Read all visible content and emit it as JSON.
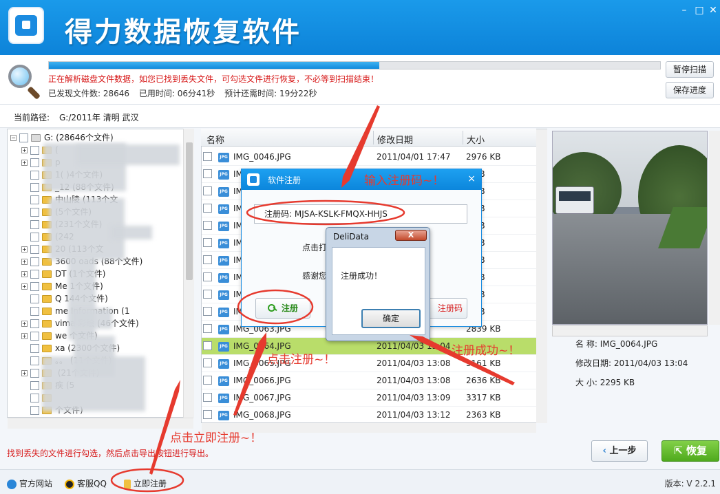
{
  "window": {
    "app_title": "得力数据恢复软件",
    "minimize": "–",
    "maximize": "□",
    "close": "✕"
  },
  "scan": {
    "progress_fraction": 0.54,
    "message": "正在解析磁盘文件数据，如您已找到丢失文件，可勾选文件进行恢复，不必等到扫描结束！",
    "found_files": "已发现文件数: 28646",
    "elapsed": "已用时间: 06分41秒",
    "remaining": "预计还需时间: 19分22秒",
    "pause_button": "暂停扫描",
    "save_button": "保存进度"
  },
  "path": {
    "label": "当前路径:",
    "value": "G:/2011年 清明  武汉"
  },
  "tree": {
    "root": "G:  (28646个文件)",
    "items": [
      "(",
      "p",
      "1(  )4个文件)",
      "_12  (88个文件)",
      "中山陵  (113个文",
      "(5个文件)",
      "(231个文件)",
      "(242",
      "20   (113个文",
      "3600   oads  (88个文件)",
      "DT   (1个文件)",
      "Me   1个文件)",
      "Q   144个文件)",
      "me Information  (1",
      "vima   彩绘  (46个文件)",
      "we   个文件)",
      "xa   (2300个文件)",
      "。。  (11个文件)",
      "  (21个文件)",
      "疾  (5",
      "",
      "个文件)"
    ]
  },
  "filelist": {
    "columns": [
      "名称",
      "修改日期",
      "大小"
    ],
    "rows": [
      {
        "name": "IMG_0046.JPG",
        "date": "2011/04/01 17:47",
        "size": "2976 KB"
      },
      {
        "name": "IM",
        "date": "",
        "size": "5 KB"
      },
      {
        "name": "IM",
        "date": "",
        "size": "2 KB"
      },
      {
        "name": "IM",
        "date": "",
        "size": "1 KB"
      },
      {
        "name": "IM",
        "date": "",
        "size": "5 KB"
      },
      {
        "name": "IM",
        "date": "",
        "size": "0 KB"
      },
      {
        "name": "IM",
        "date": "",
        "size": "2 KB"
      },
      {
        "name": "IM",
        "date": "",
        "size": "2 KB"
      },
      {
        "name": "IM",
        "date": "",
        "size": "4 KB"
      },
      {
        "name": "IM",
        "date": "",
        "size": "3 KB"
      },
      {
        "name": "IMG_0063.JPG",
        "date": "3:03",
        "size": "2839 KB"
      },
      {
        "name": "IMG_0064.JPG",
        "date": "2011/04/03 13:04",
        "size": ""
      },
      {
        "name": "IMG_0065.JPG",
        "date": "2011/04/03 13:08",
        "size": "3161 KB"
      },
      {
        "name": "IMG_0066.JPG",
        "date": "2011/04/03 13:08",
        "size": "2636 KB"
      },
      {
        "name": "IMG_0067.JPG",
        "date": "2011/04/03 13:09",
        "size": "3317 KB"
      },
      {
        "name": "IMG_0068.JPG",
        "date": "2011/04/03 13:12",
        "size": "2363 KB"
      }
    ],
    "jpg_badge": "JPG",
    "selected_row_color": "#b9dd6a"
  },
  "preview": {
    "name_label": "名    称:",
    "name_value": "IMG_0064.JPG",
    "date_label": "修改日期:",
    "date_value": "2011/04/03 13:04",
    "size_label": "大    小:",
    "size_value": "2295 KB"
  },
  "bottom": {
    "hint": "找到丢失的文件进行勾选，然后点击导出按钮进行导出。",
    "prev_button": "上一步",
    "recover_button": "恢复"
  },
  "footer": {
    "website": "官方网站",
    "qq": "客服QQ",
    "register": "立即注册",
    "version": "版本: V 2.2.1"
  },
  "reg_dialog": {
    "title": "软件注册",
    "close": "×",
    "code_label": "注册码:",
    "code_value": "MJSA-KSLK-FMQX-HHJS",
    "text1": "点击打",
    "text2": "感谢您",
    "register_button": "注册",
    "buy_button": "注册码"
  },
  "msgbox": {
    "title": "DeliData",
    "close": "X",
    "message": "注册成功！",
    "ok_button": "确定"
  },
  "annotations": {
    "enter_code": "输入注册码~！",
    "click_register": "点击注册~！",
    "register_success": "注册成功~！",
    "click_register_now": "点击立即注册~！",
    "color": "#e63a2e"
  }
}
